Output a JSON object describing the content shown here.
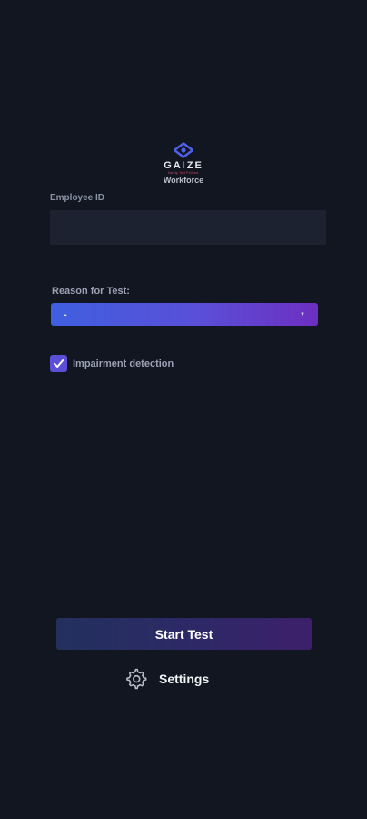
{
  "logo": {
    "word_start": "GA",
    "word_accent": "I",
    "word_end": "ZE",
    "tagline": "Safety. Not Policed.",
    "subtitle": "Workforce"
  },
  "employee": {
    "label": "Employee ID",
    "value": "",
    "placeholder": ""
  },
  "reason": {
    "label": "Reason for Test:",
    "selected": "-"
  },
  "impairment": {
    "label": "Impairment detection",
    "checked": true
  },
  "actions": {
    "start_label": "Start Test",
    "settings_label": "Settings"
  },
  "icons": {
    "logo": "eye-logo-icon",
    "caret": "caret-down-icon",
    "check": "checkmark-icon",
    "settings": "gear-icon"
  },
  "colors": {
    "background": "#111620",
    "input_background": "#1c2230",
    "accent_start": "#3f5fe0",
    "accent_end": "#6d2fc0",
    "checkbox": "#5b4fd8"
  }
}
